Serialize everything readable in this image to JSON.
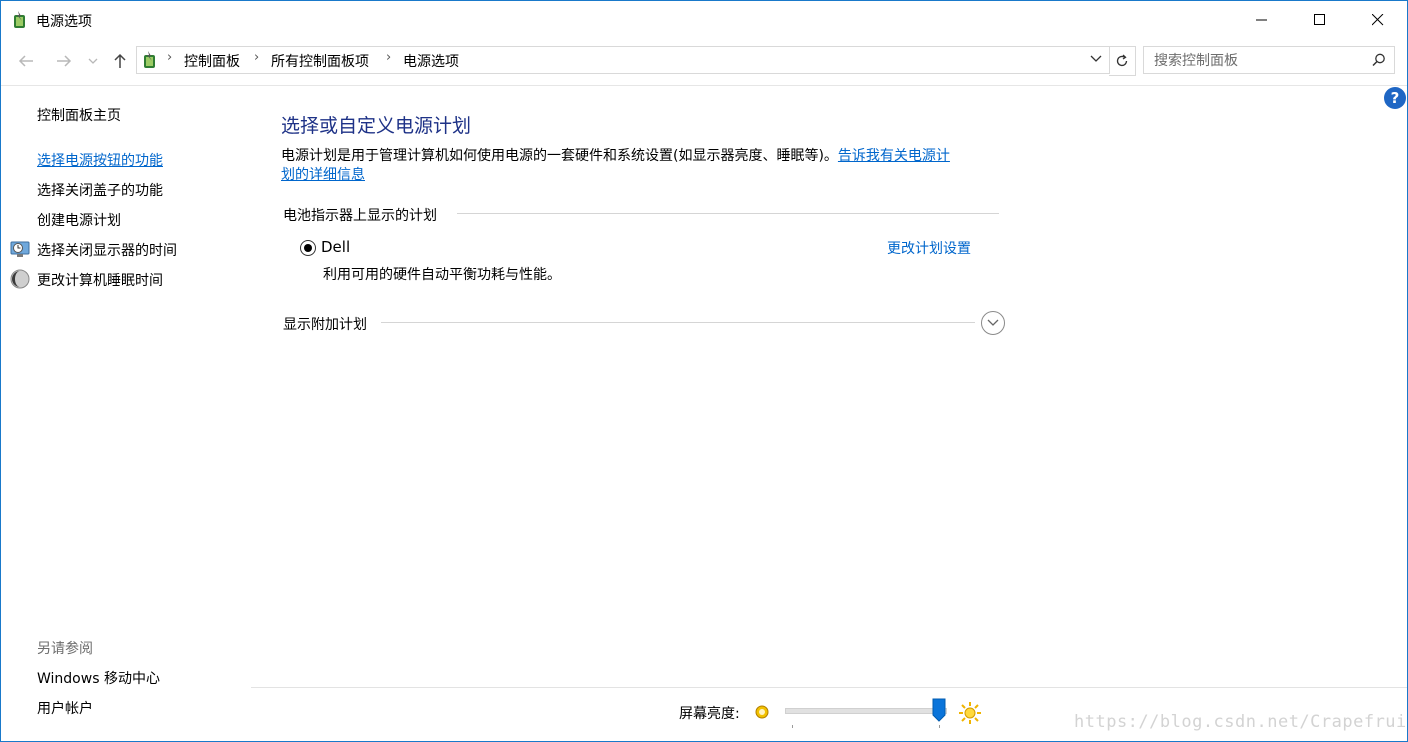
{
  "window": {
    "title": "电源选项",
    "controls": {
      "minimize": "minimize",
      "maximize": "maximize",
      "close": "close"
    }
  },
  "nav": {
    "breadcrumbs": [
      "控制面板",
      "所有控制面板项",
      "电源选项"
    ],
    "search_placeholder": "搜索控制面板"
  },
  "sidebar": {
    "home": "控制面板主页",
    "links": [
      {
        "label": "选择电源按钮的功能",
        "active": true
      },
      {
        "label": "选择关闭盖子的功能"
      },
      {
        "label": "创建电源计划"
      },
      {
        "label": "选择关闭显示器的时间",
        "icon": "display-clock-icon"
      },
      {
        "label": "更改计算机睡眠时间",
        "icon": "moon-icon"
      }
    ],
    "see_also_header": "另请参阅",
    "see_also": [
      "Windows 移动中心",
      "用户帐户"
    ]
  },
  "main": {
    "title": "选择或自定义电源计划",
    "description": "电源计划是用于管理计算机如何使用电源的一套硬件和系统设置(如显示器亮度、睡眠等)。",
    "learn_more_line1": "告诉我有关电源计",
    "learn_more_line2": "划的详细信息",
    "battery_group": "电池指示器上显示的计划",
    "plan": {
      "name": "Dell",
      "selected": true,
      "description": "利用可用的硬件自动平衡功耗与性能。",
      "change_link": "更改计划设置"
    },
    "additional_group": "显示附加计划"
  },
  "brightness": {
    "label": "屏幕亮度:",
    "level": 1.0
  },
  "help_label": "?",
  "watermark": "https://blog.csdn.net/Crapefruit",
  "colors": {
    "accent": "#1e66c4",
    "link": "#0066cc",
    "title": "#1e3287"
  }
}
